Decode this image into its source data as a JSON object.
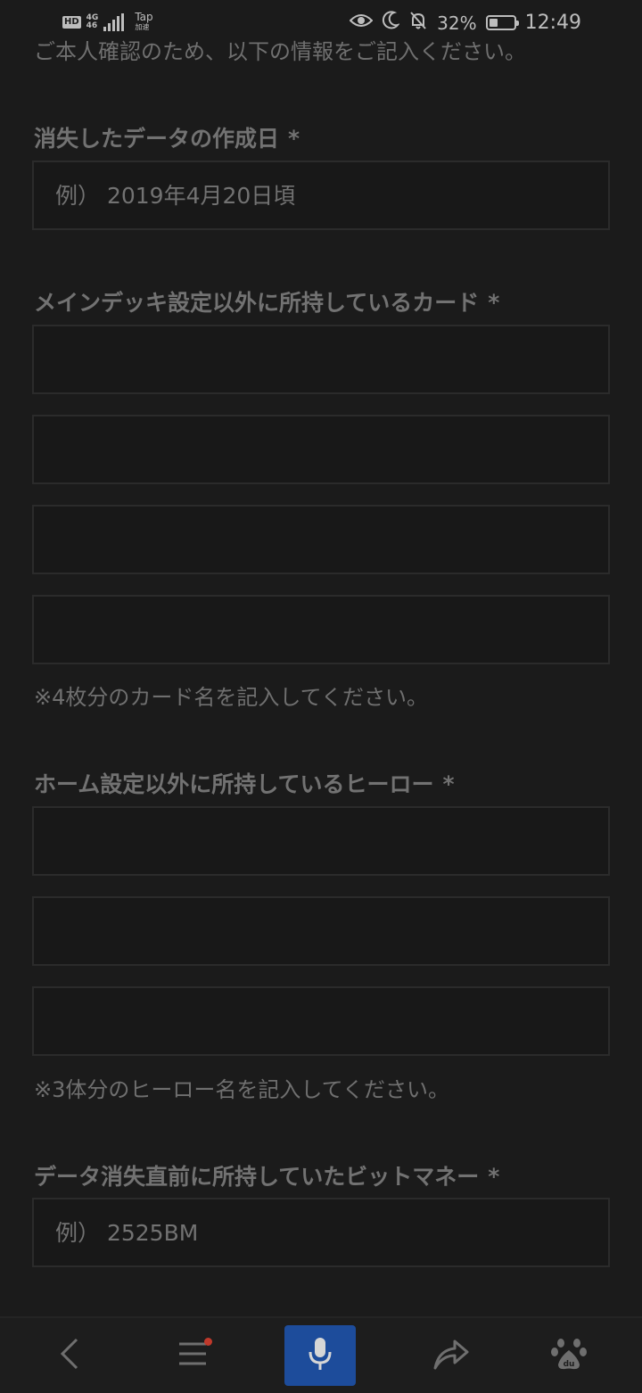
{
  "status_bar": {
    "hd": "HD",
    "network": "4G",
    "network_sub": "46",
    "tap": "Tap",
    "tap_sub": "加速",
    "battery": "32%",
    "time": "12:49",
    "icons": [
      "eye-icon",
      "moon-icon",
      "bell-off-icon",
      "battery-icon"
    ]
  },
  "intro_cut": "ご本人確認のため、以下の情報をご記入ください。",
  "form": {
    "creation_date": {
      "label": "消失したデータの作成日",
      "required": "*",
      "placeholder": "例） 2019年4月20日頃"
    },
    "cards": {
      "label": "メインデッキ設定以外に所持しているカード",
      "required": "*",
      "inputs": [
        "",
        "",
        "",
        ""
      ],
      "note": "※4枚分のカード名を記入してください。"
    },
    "heroes": {
      "label": "ホーム設定以外に所持しているヒーロー",
      "required": "*",
      "inputs": [
        "",
        "",
        ""
      ],
      "note": "※3体分のヒーロー名を記入してください。"
    },
    "bitmoney": {
      "label": "データ消失直前に所持していたビットマネー",
      "required": "*",
      "placeholder": "例） 2525BM"
    }
  },
  "bottom_nav": {
    "items": [
      "back-icon",
      "menu-icon",
      "microphone-icon",
      "share-icon",
      "baidu-paw-icon"
    ],
    "accent": "#1d4c9b",
    "badge_color": "#c0392b"
  }
}
